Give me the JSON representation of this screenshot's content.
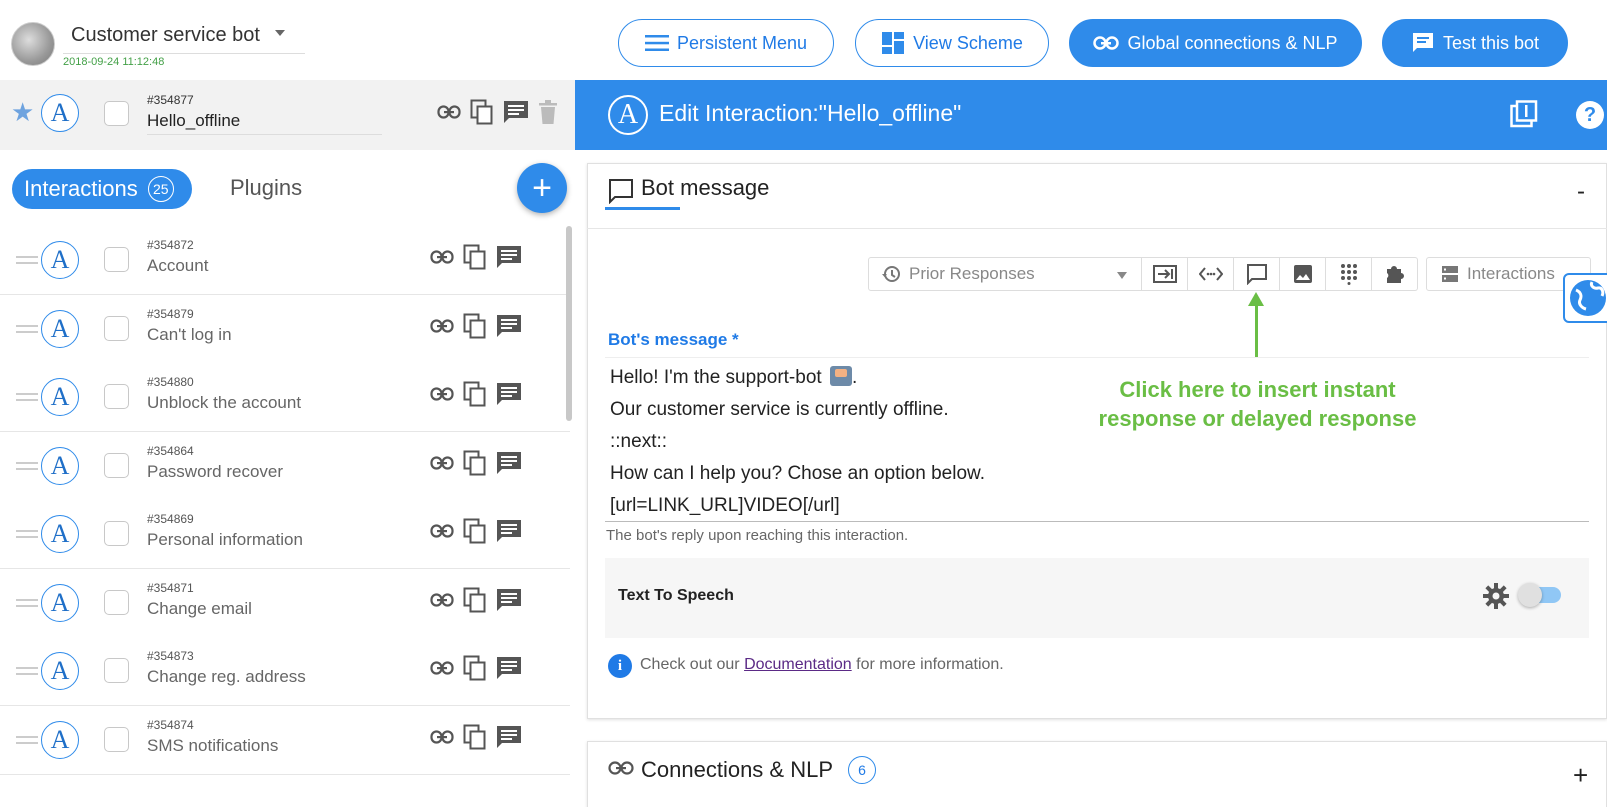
{
  "header": {
    "bot_name": "Customer service bot",
    "bot_date": "2018-09-24 11:12:48",
    "buttons": {
      "persistent_menu": "Persistent Menu",
      "view_scheme": "View Scheme",
      "global_connections": "Global connections & NLP",
      "test_bot": "Test this bot"
    }
  },
  "selected": {
    "id": "#354877",
    "name": "Hello_offline"
  },
  "tabs": {
    "interactions_label": "Interactions",
    "interactions_count": "25",
    "plugins_label": "Plugins",
    "add_label": "+"
  },
  "avatar_letter": "A",
  "interactions": [
    {
      "id": "#354872",
      "name": "Account"
    },
    {
      "id": "#354879",
      "name": "Can't log in"
    },
    {
      "id": "#354880",
      "name": "Unblock the account"
    },
    {
      "id": "#354864",
      "name": "Password recover"
    },
    {
      "id": "#354869",
      "name": "Personal information"
    },
    {
      "id": "#354871",
      "name": "Change email"
    },
    {
      "id": "#354873",
      "name": "Change reg. address"
    },
    {
      "id": "#354874",
      "name": "SMS notifications"
    }
  ],
  "edit": {
    "title": "Edit Interaction:\"Hello_offline\"",
    "help": "?"
  },
  "bot_message": {
    "section_title": "Bot message",
    "collapse": "-",
    "prior_placeholder": "Prior Responses",
    "interactions_dd": "Interactions",
    "label": "Bot's message *",
    "lines": [
      "Hello! I'm the support-bot",
      "Our customer service is currently offline.",
      "::next::",
      "How can I help you? Chose an option below.",
      "[url=LINK_URL]VIDEO[/url]"
    ],
    "line0_suffix": ".",
    "hint": "The bot's reply upon reaching this interaction.",
    "annotation_line1": "Click here to insert instant",
    "annotation_line2": "response or delayed response",
    "tts_label": "Text To Speech",
    "info_prefix": "Check out our",
    "info_link": "Documentation",
    "info_suffix": "for more information."
  },
  "connections": {
    "title": "Connections & NLP",
    "count": "6",
    "expand": "+"
  },
  "colors": {
    "primary": "#2f8bea",
    "annotation": "#6abe45",
    "date": "#43a047"
  }
}
